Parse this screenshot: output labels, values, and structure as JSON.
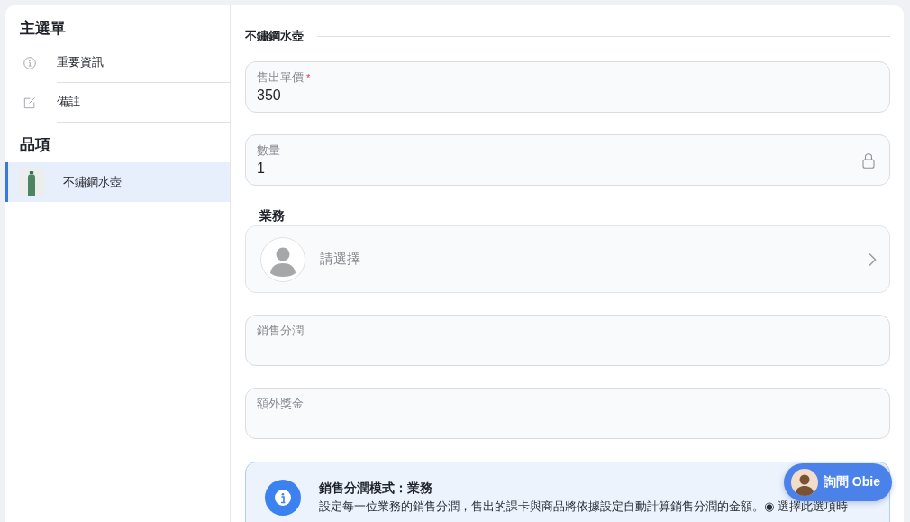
{
  "sidebar": {
    "title": "主選單",
    "menu": [
      {
        "label": "重要資訊"
      },
      {
        "label": "備註"
      }
    ],
    "products": {
      "title": "品項",
      "items": [
        {
          "label": "不鏽鋼水壺",
          "selected": true
        }
      ]
    }
  },
  "main": {
    "section_title": "不鏽鋼水壺",
    "fields": [
      {
        "kind": "input",
        "label": "售出單價",
        "required_mark": "*",
        "value": "350",
        "locked": false
      },
      {
        "kind": "input",
        "label": "數量",
        "value": "1",
        "locked": true
      },
      {
        "kind": "picker",
        "label": "業務",
        "placeholder": "請選擇"
      },
      {
        "kind": "input",
        "label": "銷售分潤",
        "locked": false
      },
      {
        "kind": "input",
        "label": "額外獎金",
        "locked": false
      }
    ],
    "notice": {
      "title": "銷售分潤模式：業務",
      "text": "設定每一位業務的銷售分潤，售出的課卡與商品將依據設定自動計算銷售分潤的金額。◉ 選擇此選項時"
    }
  },
  "chat_button": {
    "label": "詢問 Obie"
  }
}
